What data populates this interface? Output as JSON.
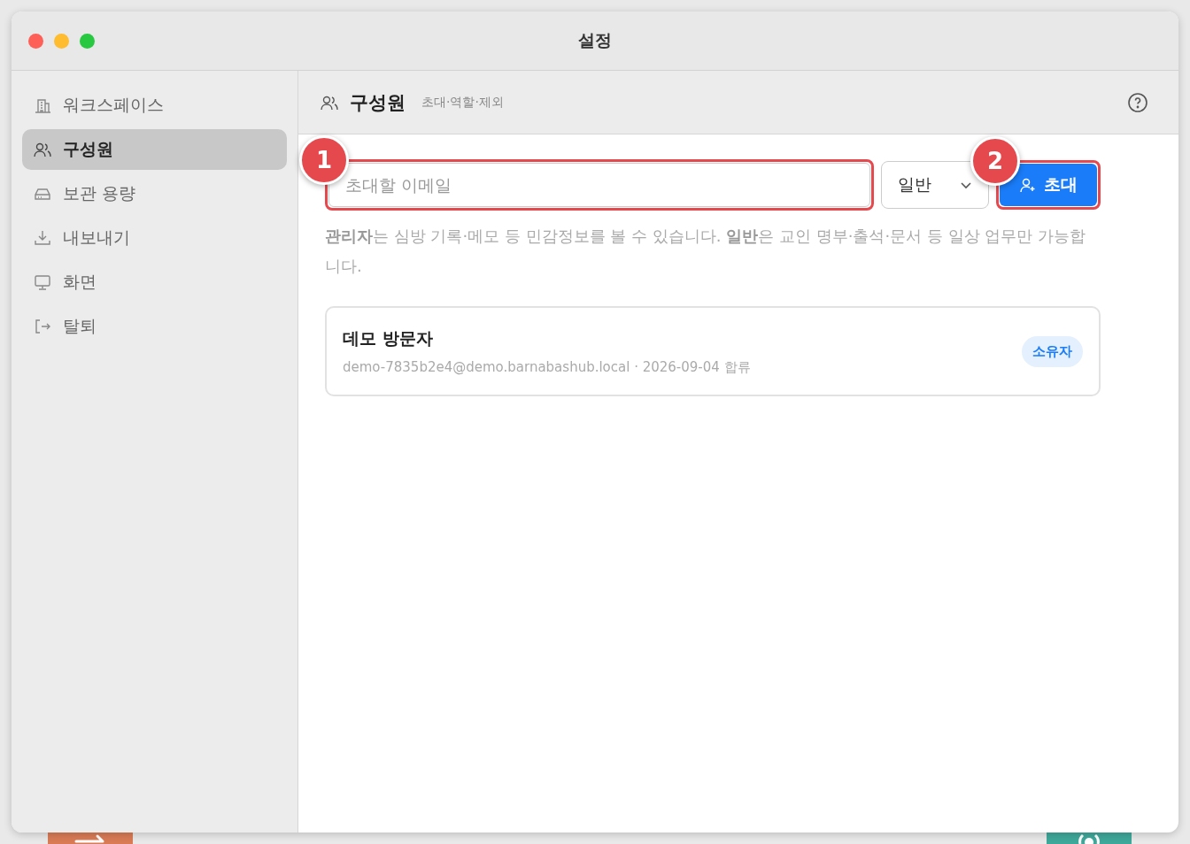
{
  "window": {
    "title": "설정"
  },
  "sidebar": {
    "items": [
      {
        "label": "워크스페이스",
        "selected": false
      },
      {
        "label": "구성원",
        "selected": true
      },
      {
        "label": "보관 용량",
        "selected": false
      },
      {
        "label": "내보내기",
        "selected": false
      },
      {
        "label": "화면",
        "selected": false
      },
      {
        "label": "탈퇴",
        "selected": false
      }
    ]
  },
  "header": {
    "title": "구성원",
    "subtitle": "초대·역할·제외"
  },
  "invite": {
    "email_placeholder": "초대할 이메일",
    "role": "일반",
    "button": "초대"
  },
  "help_text": "**관리자**는 심방 기록·메모 등 민감정보를 볼 수 있습니다. **일반**은 교인 명부·출석·문서 등 일상 업무만 가능합니다.",
  "members": [
    {
      "name": "데모 방문자",
      "detail": "demo-7835b2e4@demo.barnabashub.local · 2026-09-04 합류",
      "role": "소유자"
    }
  ],
  "callouts": [
    {
      "number": "1"
    },
    {
      "number": "2"
    }
  ]
}
